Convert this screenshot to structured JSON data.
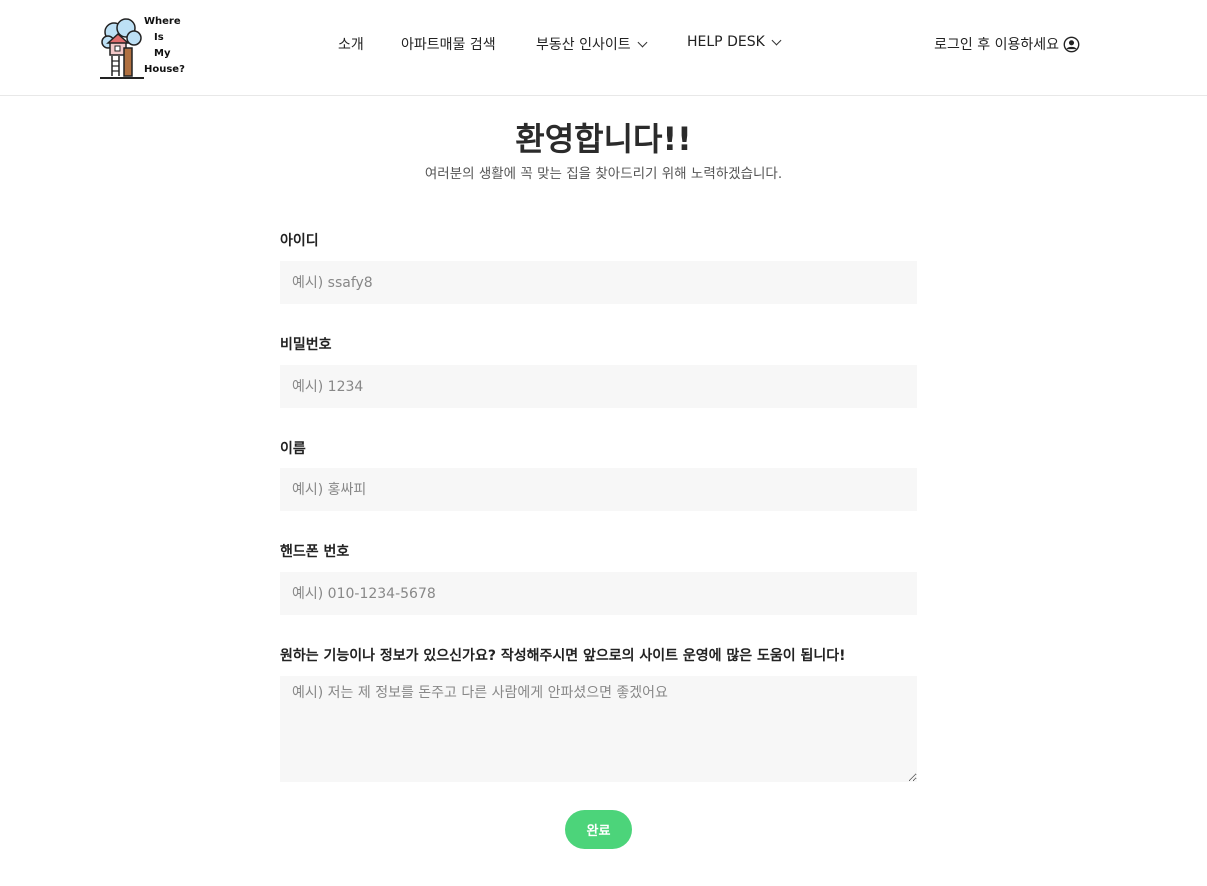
{
  "logo": {
    "lines": [
      "Where",
      "Is",
      "My",
      "House?"
    ]
  },
  "nav": {
    "items": [
      {
        "label": "소개",
        "has_dropdown": false
      },
      {
        "label": "아파트매물 검색",
        "has_dropdown": false
      },
      {
        "label": "부동산 인사이트",
        "has_dropdown": true
      },
      {
        "label": "HELP DESK",
        "has_dropdown": true
      }
    ],
    "login_label": "로그인 후 이용하세요"
  },
  "page": {
    "title": "환영합니다!!",
    "subtitle": "여러분의 생활에 꼭 맞는 집을 찾아드리기 위해 노력하겠습니다."
  },
  "form": {
    "id": {
      "label": "아이디",
      "placeholder": "예시) ssafy8",
      "value": ""
    },
    "password": {
      "label": "비밀번호",
      "placeholder": "예시) 1234",
      "value": ""
    },
    "name": {
      "label": "이름",
      "placeholder": "예시) 홍싸피",
      "value": ""
    },
    "phone": {
      "label": "핸드폰 번호",
      "placeholder": "예시) 010-1234-5678",
      "value": ""
    },
    "request": {
      "label": "원하는 기능이나 정보가 있으신가요? 작성해주시면 앞으로의 사이트 운영에 많은 도움이 됩니다!",
      "placeholder": "예시) 저는 제 정보를 돈주고 다른 사람에게 안파셨으면 좋겠어요",
      "value": ""
    },
    "submit_label": "완료"
  },
  "colors": {
    "accent": "#4cd47a",
    "input_bg": "#f7f7f7",
    "text": "#222222"
  },
  "icons": {
    "user": "user-circle-icon",
    "dropdown": "chevron-down-icon"
  }
}
